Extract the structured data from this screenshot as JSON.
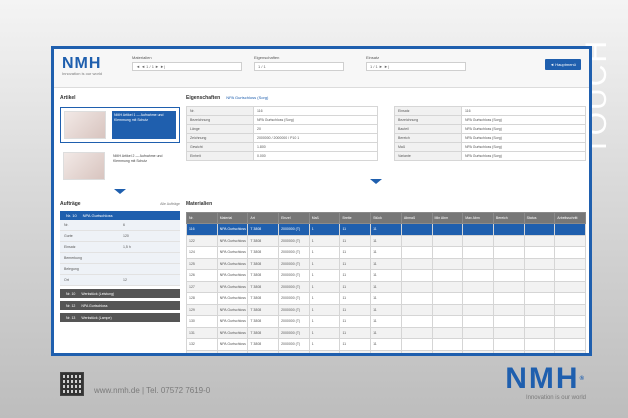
{
  "poster": {
    "touch_label": "TOUCH",
    "footer": "www.nmh.de | Tel. 07572 7619-0",
    "brand": "NMH",
    "brand_reg": "®",
    "tagline": "Innovation is our world"
  },
  "app": {
    "logo": "NMH",
    "logo_sub": "Innovation is our world",
    "toolbar": [
      {
        "label": "Materialien",
        "value": "◄ ◄  1 / 1  ► ►|"
      },
      {
        "label": "Eigenschaften",
        "value": "1 / 1"
      },
      {
        "label": "Einsatz",
        "value": "1 / 1  ► ►|"
      }
    ],
    "action_button": "◄ Hauptmenü",
    "artikel": {
      "title": "Artikel",
      "items": [
        {
          "text": "NMH Artikel 1 — Aufnahme und Klemmung mit Schutz"
        },
        {
          "text": "NMH Artikel 2 — Aufnahme und Klemmung mit Schutz"
        }
      ]
    },
    "props": {
      "title": "Eigenschaften",
      "subtitle": "NPA Gurtschloss (Sorg)",
      "left": [
        {
          "k": "Nr.",
          "v": "116"
        },
        {
          "k": "Bezeichnung",
          "v": "NPA Gurtschloss (Sorg)"
        },
        {
          "k": "Länge",
          "v": "20"
        },
        {
          "k": "Zeichnung",
          "v": "2000000 / 2000000 / P10 1"
        },
        {
          "k": "Gewicht",
          "v": "1.800"
        },
        {
          "k": "Einheit",
          "v": "0.000"
        }
      ],
      "right": [
        {
          "k": "Einsatz",
          "v": "116"
        },
        {
          "k": "Bezeichnung",
          "v": "NPA Gurtschloss (Sorg)"
        },
        {
          "k": "Bauteil",
          "v": "NPA Gurtschloss (Sorg)"
        },
        {
          "k": "Bereich",
          "v": "NPA Gurtschloss (Sorg)"
        },
        {
          "k": "Maß",
          "v": "NPA Gurtschloss (Sorg)"
        },
        {
          "k": "Variante",
          "v": "NPA Gurtschloss (Sorg)"
        }
      ]
    },
    "orders": {
      "title": "Aufträge",
      "tiny": "Alle Aufträge",
      "selected": [
        "Nr. 10",
        "NPA Gurtschloss"
      ],
      "rows": [
        [
          "Nr.",
          "6"
        ],
        [
          "Gurte",
          "120"
        ],
        [
          "Einsatz",
          "1,5 h"
        ],
        [
          "Bemerkung",
          ""
        ],
        [
          "Belegung",
          ""
        ],
        [
          "Ort",
          "12"
        ]
      ],
      "buttons": [
        [
          "Nr. 10",
          "Werkstück (Leistung)"
        ],
        [
          "Nr. 12",
          "NPA Gurtschloss"
        ],
        [
          "Nr. 13",
          "Werkstück (Lampe)"
        ]
      ]
    },
    "materials": {
      "title": "Materialien",
      "columns": [
        "Nr.",
        "Material",
        "Art",
        "Einzel",
        "Maß",
        "Breite",
        "Stück",
        "Abmaß",
        "Min Abm",
        "Max Abm",
        "Bereich",
        "Status",
        "Arbeitsschritt"
      ],
      "rows": [
        [
          "116",
          "NPA Gurtschloss (Sorg)",
          "T 3808",
          "2000000 (T)",
          "1",
          "11",
          "11",
          "",
          "",
          "",
          "",
          "",
          ""
        ],
        [
          "122",
          "NPA Gurtschloss (Sorg)",
          "T 3808",
          "2000000 (T)",
          "1",
          "11",
          "11",
          "",
          "",
          "",
          "",
          "",
          ""
        ],
        [
          "124",
          "NPA Gurtschloss (Sorg)",
          "T 3808",
          "2000000 (T)",
          "1",
          "11",
          "11",
          "",
          "",
          "",
          "",
          "",
          ""
        ],
        [
          "125",
          "NPA Gurtschloss (Sorg)",
          "T 3808",
          "2000000 (T)",
          "1",
          "11",
          "11",
          "",
          "",
          "",
          "",
          "",
          ""
        ],
        [
          "126",
          "NPA Gurtschloss (Sorg)",
          "T 3808",
          "2000000 (T)",
          "1",
          "11",
          "11",
          "",
          "",
          "",
          "",
          "",
          ""
        ],
        [
          "127",
          "NPA Gurtschloss (Sorg)",
          "T 3808",
          "2000000 (T)",
          "1",
          "11",
          "11",
          "",
          "",
          "",
          "",
          "",
          ""
        ],
        [
          "128",
          "NPA Gurtschloss (Sorg)",
          "T 3808",
          "2000000 (T)",
          "1",
          "11",
          "11",
          "",
          "",
          "",
          "",
          "",
          ""
        ],
        [
          "129",
          "NPA Gurtschloss (Sorg)",
          "T 3808",
          "2000000 (T)",
          "1",
          "11",
          "11",
          "",
          "",
          "",
          "",
          "",
          ""
        ],
        [
          "130",
          "NPA Gurtschloss (Sorg)",
          "T 3808",
          "2000000 (T)",
          "1",
          "11",
          "11",
          "",
          "",
          "",
          "",
          "",
          ""
        ],
        [
          "131",
          "NPA Gurtschloss (Sorg)",
          "T 3808",
          "2000000 (T)",
          "1",
          "11",
          "11",
          "",
          "",
          "",
          "",
          "",
          ""
        ],
        [
          "132",
          "NPA Gurtschloss (Sorg)",
          "T 3808",
          "2000000 (T)",
          "1",
          "11",
          "11",
          "",
          "",
          "",
          "",
          "",
          ""
        ],
        [
          "133",
          "NPA Gurtschloss (Sorg)",
          "T 3808",
          "2000000 (T)",
          "1",
          "11",
          "11",
          "",
          "",
          "",
          "",
          "",
          ""
        ],
        [
          "134",
          "NPA Gurtschloss (Sorg)",
          "T 3808",
          "2000000 (T)",
          "1",
          "11",
          "11",
          "",
          "",
          "",
          "",
          "",
          ""
        ]
      ]
    }
  }
}
